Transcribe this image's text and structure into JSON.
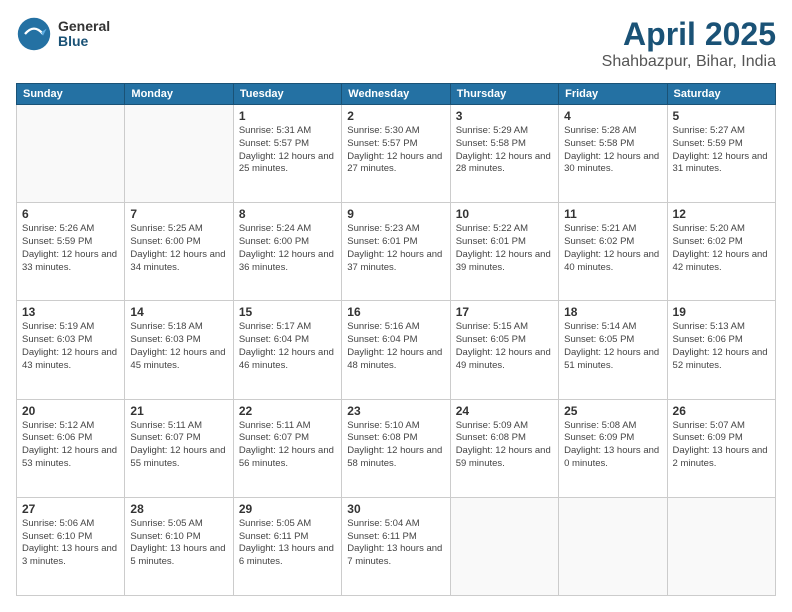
{
  "header": {
    "logo": {
      "general": "General",
      "blue": "Blue"
    },
    "title": "April 2025",
    "subtitle": "Shahbazpur, Bihar, India"
  },
  "weekdays": [
    "Sunday",
    "Monday",
    "Tuesday",
    "Wednesday",
    "Thursday",
    "Friday",
    "Saturday"
  ],
  "weeks": [
    [
      {
        "day": "",
        "sunrise": "",
        "sunset": "",
        "daylight": ""
      },
      {
        "day": "",
        "sunrise": "",
        "sunset": "",
        "daylight": ""
      },
      {
        "day": "1",
        "sunrise": "Sunrise: 5:31 AM",
        "sunset": "Sunset: 5:57 PM",
        "daylight": "Daylight: 12 hours and 25 minutes."
      },
      {
        "day": "2",
        "sunrise": "Sunrise: 5:30 AM",
        "sunset": "Sunset: 5:57 PM",
        "daylight": "Daylight: 12 hours and 27 minutes."
      },
      {
        "day": "3",
        "sunrise": "Sunrise: 5:29 AM",
        "sunset": "Sunset: 5:58 PM",
        "daylight": "Daylight: 12 hours and 28 minutes."
      },
      {
        "day": "4",
        "sunrise": "Sunrise: 5:28 AM",
        "sunset": "Sunset: 5:58 PM",
        "daylight": "Daylight: 12 hours and 30 minutes."
      },
      {
        "day": "5",
        "sunrise": "Sunrise: 5:27 AM",
        "sunset": "Sunset: 5:59 PM",
        "daylight": "Daylight: 12 hours and 31 minutes."
      }
    ],
    [
      {
        "day": "6",
        "sunrise": "Sunrise: 5:26 AM",
        "sunset": "Sunset: 5:59 PM",
        "daylight": "Daylight: 12 hours and 33 minutes."
      },
      {
        "day": "7",
        "sunrise": "Sunrise: 5:25 AM",
        "sunset": "Sunset: 6:00 PM",
        "daylight": "Daylight: 12 hours and 34 minutes."
      },
      {
        "day": "8",
        "sunrise": "Sunrise: 5:24 AM",
        "sunset": "Sunset: 6:00 PM",
        "daylight": "Daylight: 12 hours and 36 minutes."
      },
      {
        "day": "9",
        "sunrise": "Sunrise: 5:23 AM",
        "sunset": "Sunset: 6:01 PM",
        "daylight": "Daylight: 12 hours and 37 minutes."
      },
      {
        "day": "10",
        "sunrise": "Sunrise: 5:22 AM",
        "sunset": "Sunset: 6:01 PM",
        "daylight": "Daylight: 12 hours and 39 minutes."
      },
      {
        "day": "11",
        "sunrise": "Sunrise: 5:21 AM",
        "sunset": "Sunset: 6:02 PM",
        "daylight": "Daylight: 12 hours and 40 minutes."
      },
      {
        "day": "12",
        "sunrise": "Sunrise: 5:20 AM",
        "sunset": "Sunset: 6:02 PM",
        "daylight": "Daylight: 12 hours and 42 minutes."
      }
    ],
    [
      {
        "day": "13",
        "sunrise": "Sunrise: 5:19 AM",
        "sunset": "Sunset: 6:03 PM",
        "daylight": "Daylight: 12 hours and 43 minutes."
      },
      {
        "day": "14",
        "sunrise": "Sunrise: 5:18 AM",
        "sunset": "Sunset: 6:03 PM",
        "daylight": "Daylight: 12 hours and 45 minutes."
      },
      {
        "day": "15",
        "sunrise": "Sunrise: 5:17 AM",
        "sunset": "Sunset: 6:04 PM",
        "daylight": "Daylight: 12 hours and 46 minutes."
      },
      {
        "day": "16",
        "sunrise": "Sunrise: 5:16 AM",
        "sunset": "Sunset: 6:04 PM",
        "daylight": "Daylight: 12 hours and 48 minutes."
      },
      {
        "day": "17",
        "sunrise": "Sunrise: 5:15 AM",
        "sunset": "Sunset: 6:05 PM",
        "daylight": "Daylight: 12 hours and 49 minutes."
      },
      {
        "day": "18",
        "sunrise": "Sunrise: 5:14 AM",
        "sunset": "Sunset: 6:05 PM",
        "daylight": "Daylight: 12 hours and 51 minutes."
      },
      {
        "day": "19",
        "sunrise": "Sunrise: 5:13 AM",
        "sunset": "Sunset: 6:06 PM",
        "daylight": "Daylight: 12 hours and 52 minutes."
      }
    ],
    [
      {
        "day": "20",
        "sunrise": "Sunrise: 5:12 AM",
        "sunset": "Sunset: 6:06 PM",
        "daylight": "Daylight: 12 hours and 53 minutes."
      },
      {
        "day": "21",
        "sunrise": "Sunrise: 5:11 AM",
        "sunset": "Sunset: 6:07 PM",
        "daylight": "Daylight: 12 hours and 55 minutes."
      },
      {
        "day": "22",
        "sunrise": "Sunrise: 5:11 AM",
        "sunset": "Sunset: 6:07 PM",
        "daylight": "Daylight: 12 hours and 56 minutes."
      },
      {
        "day": "23",
        "sunrise": "Sunrise: 5:10 AM",
        "sunset": "Sunset: 6:08 PM",
        "daylight": "Daylight: 12 hours and 58 minutes."
      },
      {
        "day": "24",
        "sunrise": "Sunrise: 5:09 AM",
        "sunset": "Sunset: 6:08 PM",
        "daylight": "Daylight: 12 hours and 59 minutes."
      },
      {
        "day": "25",
        "sunrise": "Sunrise: 5:08 AM",
        "sunset": "Sunset: 6:09 PM",
        "daylight": "Daylight: 13 hours and 0 minutes."
      },
      {
        "day": "26",
        "sunrise": "Sunrise: 5:07 AM",
        "sunset": "Sunset: 6:09 PM",
        "daylight": "Daylight: 13 hours and 2 minutes."
      }
    ],
    [
      {
        "day": "27",
        "sunrise": "Sunrise: 5:06 AM",
        "sunset": "Sunset: 6:10 PM",
        "daylight": "Daylight: 13 hours and 3 minutes."
      },
      {
        "day": "28",
        "sunrise": "Sunrise: 5:05 AM",
        "sunset": "Sunset: 6:10 PM",
        "daylight": "Daylight: 13 hours and 5 minutes."
      },
      {
        "day": "29",
        "sunrise": "Sunrise: 5:05 AM",
        "sunset": "Sunset: 6:11 PM",
        "daylight": "Daylight: 13 hours and 6 minutes."
      },
      {
        "day": "30",
        "sunrise": "Sunrise: 5:04 AM",
        "sunset": "Sunset: 6:11 PM",
        "daylight": "Daylight: 13 hours and 7 minutes."
      },
      {
        "day": "",
        "sunrise": "",
        "sunset": "",
        "daylight": ""
      },
      {
        "day": "",
        "sunrise": "",
        "sunset": "",
        "daylight": ""
      },
      {
        "day": "",
        "sunrise": "",
        "sunset": "",
        "daylight": ""
      }
    ]
  ]
}
